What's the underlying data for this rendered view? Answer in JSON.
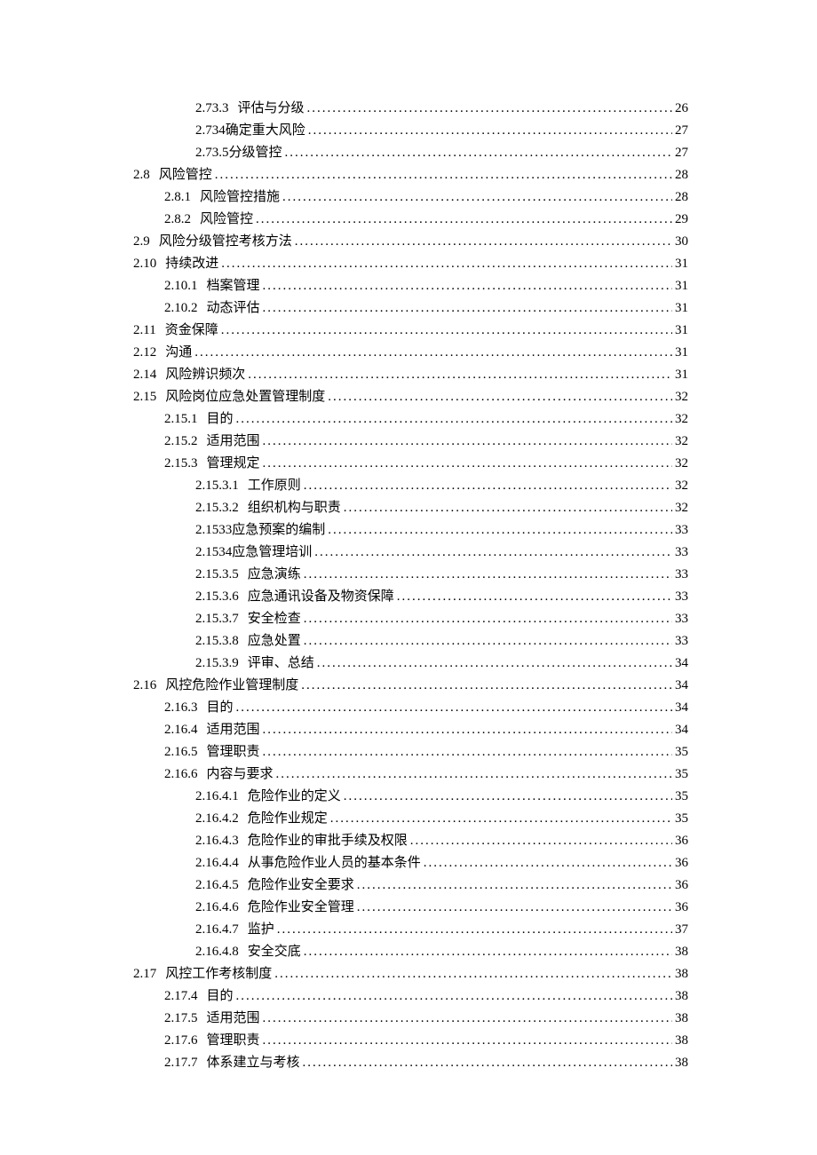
{
  "entries": [
    {
      "indent": 2,
      "num": "2.73.3",
      "title": "评估与分级",
      "page": "26"
    },
    {
      "indent": 2,
      "num": "2.734",
      "title": " 确定重大风险",
      "page": "27",
      "nogap": true
    },
    {
      "indent": 2,
      "num": "2.73.5",
      "title": " 分级管控",
      "page": "27",
      "nogap": true
    },
    {
      "indent": 0,
      "num": "2.8",
      "title": "风险管控",
      "page": "28"
    },
    {
      "indent": 1,
      "num": "2.8.1",
      "title": "风险管控措施",
      "page": "28"
    },
    {
      "indent": 1,
      "num": "2.8.2",
      "title": "风险管控",
      "page": "29"
    },
    {
      "indent": 0,
      "num": "2.9",
      "title": "风险分级管控考核方法",
      "page": "30"
    },
    {
      "indent": 0,
      "num": "2.10",
      "title": "持续改进",
      "page": "31"
    },
    {
      "indent": 1,
      "num": "2.10.1",
      "title": "档案管理",
      "page": "31"
    },
    {
      "indent": 1,
      "num": "2.10.2",
      "title": "动态评估",
      "page": "31"
    },
    {
      "indent": 0,
      "num": "2.11",
      "title": "资金保障",
      "page": "31"
    },
    {
      "indent": 0,
      "num": "2.12",
      "title": "沟通",
      "page": "31"
    },
    {
      "indent": 0,
      "num": "2.14",
      "title": "风险辨识频次",
      "page": "31"
    },
    {
      "indent": 0,
      "num": "2.15",
      "title": "风险岗位应急处置管理制度",
      "page": "32"
    },
    {
      "indent": 1,
      "num": "2.15.1",
      "title": "目的",
      "page": "32"
    },
    {
      "indent": 1,
      "num": "2.15.2",
      "title": "适用范围",
      "page": "32"
    },
    {
      "indent": 1,
      "num": "2.15.3",
      "title": "管理规定",
      "page": "32"
    },
    {
      "indent": 2,
      "num": "2.15.3.1",
      "title": "工作原则",
      "page": "32"
    },
    {
      "indent": 2,
      "num": "2.15.3.2",
      "title": "组织机构与职责",
      "page": "32"
    },
    {
      "indent": 2,
      "num": "2.1533",
      "title": " 应急预案的编制",
      "page": "33",
      "nogap": true
    },
    {
      "indent": 2,
      "num": "2.1534",
      "title": " 应急管理培训",
      "page": "33",
      "nogap": true
    },
    {
      "indent": 2,
      "num": "2.15.3.5",
      "title": "应急演练",
      "page": "33"
    },
    {
      "indent": 2,
      "num": "2.15.3.6",
      "title": "应急通讯设备及物资保障",
      "page": "33"
    },
    {
      "indent": 2,
      "num": "2.15.3.7",
      "title": "安全检查",
      "page": "33"
    },
    {
      "indent": 2,
      "num": "2.15.3.8",
      "title": "应急处置",
      "page": "33"
    },
    {
      "indent": 2,
      "num": "2.15.3.9",
      "title": "评审、总结",
      "page": "34"
    },
    {
      "indent": 0,
      "num": "2.16",
      "title": "风控危险作业管理制度",
      "page": "34"
    },
    {
      "indent": 1,
      "num": "2.16.3",
      "title": "目的",
      "page": "34"
    },
    {
      "indent": 1,
      "num": "2.16.4",
      "title": "适用范围",
      "page": "34"
    },
    {
      "indent": 1,
      "num": "2.16.5",
      "title": "管理职责",
      "page": "35"
    },
    {
      "indent": 1,
      "num": "2.16.6",
      "title": "内容与要求",
      "page": "35"
    },
    {
      "indent": 2,
      "num": "2.16.4.1",
      "title": "危险作业的定义",
      "page": "35"
    },
    {
      "indent": 2,
      "num": "2.16.4.2",
      "title": "危险作业规定",
      "page": "35"
    },
    {
      "indent": 2,
      "num": "2.16.4.3",
      "title": "危险作业的审批手续及权限",
      "page": "36"
    },
    {
      "indent": 2,
      "num": "2.16.4.4",
      "title": "从事危险作业人员的基本条件",
      "page": "36"
    },
    {
      "indent": 2,
      "num": "2.16.4.5",
      "title": "危险作业安全要求",
      "page": "36"
    },
    {
      "indent": 2,
      "num": "2.16.4.6",
      "title": "危险作业安全管理",
      "page": "36"
    },
    {
      "indent": 2,
      "num": "2.16.4.7",
      "title": "监护",
      "page": "37"
    },
    {
      "indent": 2,
      "num": "2.16.4.8",
      "title": "安全交底",
      "page": "38"
    },
    {
      "indent": 0,
      "num": "2.17",
      "title": "风控工作考核制度",
      "page": "38"
    },
    {
      "indent": 1,
      "num": "2.17.4",
      "title": "目的",
      "page": "38"
    },
    {
      "indent": 1,
      "num": "2.17.5",
      "title": "适用范围",
      "page": "38"
    },
    {
      "indent": 1,
      "num": "2.17.6",
      "title": "管理职责",
      "page": "38"
    },
    {
      "indent": 1,
      "num": "2.17.7",
      "title": "体系建立与考核",
      "page": "38"
    }
  ]
}
